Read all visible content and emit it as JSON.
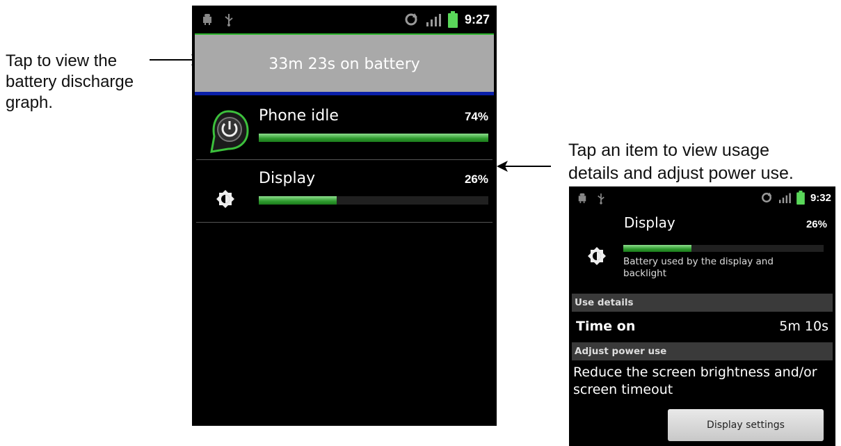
{
  "annotations": {
    "left_line1": "Tap to view the",
    "left_line2": "battery discharge",
    "left_line3": "graph.",
    "right_line1": "Tap an item to view usage",
    "right_line2": "details and adjust power use."
  },
  "main_screen": {
    "status_bar": {
      "time": "9:27",
      "left_icons": [
        "android-debug-icon",
        "usb-icon"
      ],
      "right_icons": [
        "sync-icon",
        "signal-icon",
        "battery-icon"
      ]
    },
    "battery_header": "33m 23s on battery",
    "items": [
      {
        "label": "Phone idle",
        "percent": "74%",
        "fraction": 0.74,
        "icon": "power-icon"
      },
      {
        "label": "Display",
        "percent": "26%",
        "fraction": 0.26,
        "icon": "brightness-icon"
      }
    ]
  },
  "detail_screen": {
    "status_bar": {
      "time": "9:32"
    },
    "title": "Display",
    "percent": "26%",
    "fraction": 0.26,
    "description": "Battery used by the display and backlight",
    "use_details_header": "Use details",
    "time_on_label": "Time on",
    "time_on_value": "5m 10s",
    "adjust_header": "Adjust power use",
    "advice": "Reduce the screen brightness and/or screen timeout",
    "button_label": "Display settings"
  },
  "colors": {
    "accent_green": "#2cb52c",
    "header_gray": "#a9a9a9",
    "divider_blue": "#0a1fa8"
  }
}
